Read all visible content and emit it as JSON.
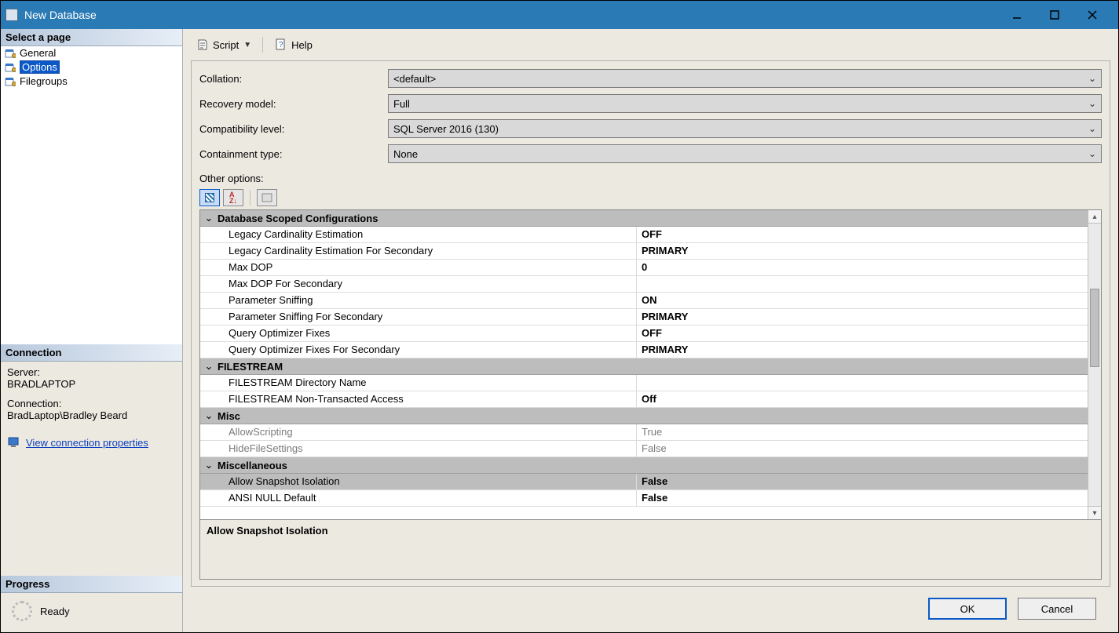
{
  "title": "New Database",
  "left": {
    "select_page": "Select a page",
    "pages": [
      "General",
      "Options",
      "Filegroups"
    ],
    "selected_index": 1,
    "connection_header": "Connection",
    "server_label": "Server:",
    "server_value": "BRADLAPTOP",
    "connection_label": "Connection:",
    "connection_value": "BradLaptop\\Bradley Beard",
    "view_conn_link": "View connection properties",
    "progress_header": "Progress",
    "progress_status": "Ready"
  },
  "toolbar": {
    "script": "Script",
    "help": "Help"
  },
  "form": {
    "collation_label": "Collation:",
    "collation_value": "<default>",
    "recovery_label": "Recovery model:",
    "recovery_value": "Full",
    "compat_label": "Compatibility level:",
    "compat_value": "SQL Server 2016 (130)",
    "containment_label": "Containment type:",
    "containment_value": "None",
    "other_options": "Other options:"
  },
  "groups": [
    {
      "title": "Database Scoped Configurations",
      "rows": [
        {
          "name": "Legacy Cardinality Estimation",
          "value": "OFF",
          "bold": true
        },
        {
          "name": "Legacy Cardinality Estimation For Secondary",
          "value": "PRIMARY",
          "bold": true
        },
        {
          "name": "Max DOP",
          "value": "0",
          "bold": true
        },
        {
          "name": "Max DOP For Secondary",
          "value": "",
          "bold": false
        },
        {
          "name": "Parameter Sniffing",
          "value": "ON",
          "bold": true
        },
        {
          "name": "Parameter Sniffing For Secondary",
          "value": "PRIMARY",
          "bold": true
        },
        {
          "name": "Query Optimizer Fixes",
          "value": "OFF",
          "bold": true
        },
        {
          "name": "Query Optimizer Fixes For Secondary",
          "value": "PRIMARY",
          "bold": true
        }
      ]
    },
    {
      "title": "FILESTREAM",
      "rows": [
        {
          "name": "FILESTREAM Directory Name",
          "value": "",
          "bold": false
        },
        {
          "name": "FILESTREAM Non-Transacted Access",
          "value": "Off",
          "bold": true
        }
      ]
    },
    {
      "title": "Misc",
      "rows": [
        {
          "name": "AllowScripting",
          "value": "True",
          "bold": false,
          "disabled": true
        },
        {
          "name": "HideFileSettings",
          "value": "False",
          "bold": false,
          "disabled": true
        }
      ]
    },
    {
      "title": "Miscellaneous",
      "rows": [
        {
          "name": "Allow Snapshot Isolation",
          "value": "False",
          "bold": true,
          "selected": true
        },
        {
          "name": "ANSI NULL Default",
          "value": "False",
          "bold": true
        }
      ]
    }
  ],
  "description_title": "Allow Snapshot Isolation",
  "buttons": {
    "ok": "OK",
    "cancel": "Cancel"
  }
}
